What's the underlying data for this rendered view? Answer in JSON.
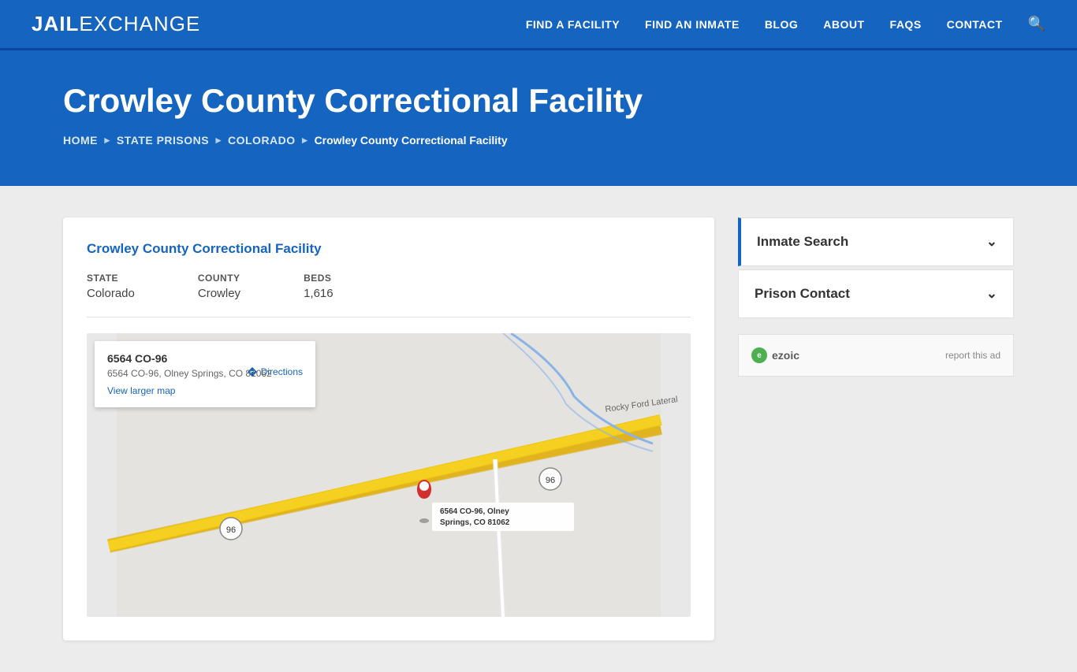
{
  "header": {
    "logo_jail": "JAIL",
    "logo_exchange": "EXCHANGE",
    "nav": [
      {
        "label": "FIND A FACILITY",
        "id": "find-facility"
      },
      {
        "label": "FIND AN INMATE",
        "id": "find-inmate"
      },
      {
        "label": "BLOG",
        "id": "blog"
      },
      {
        "label": "ABOUT",
        "id": "about"
      },
      {
        "label": "FAQs",
        "id": "faqs"
      },
      {
        "label": "CONTACT",
        "id": "contact"
      }
    ]
  },
  "hero": {
    "title": "Crowley County Correctional Facility",
    "breadcrumb": {
      "home": "Home",
      "state_prisons": "State Prisons",
      "state": "Colorado",
      "current": "Crowley County Correctional Facility"
    }
  },
  "facility": {
    "name": "Crowley County Correctional Facility",
    "state_label": "STATE",
    "state_value": "Colorado",
    "county_label": "COUNTY",
    "county_value": "Crowley",
    "beds_label": "BEDS",
    "beds_value": "1,616"
  },
  "map": {
    "address_title": "6564 CO-96",
    "address_line": "6564 CO-96, Olney Springs, CO 81062",
    "directions_label": "Directions",
    "view_larger_label": "View larger map",
    "pin_label": "6564 CO-96, Olney Springs, CO 81062"
  },
  "sidebar": {
    "inmate_search_label": "Inmate Search",
    "prison_contact_label": "Prison Contact",
    "chevron": "∨"
  },
  "ad": {
    "ezoic_label": "ezoic",
    "report_label": "report this ad"
  }
}
